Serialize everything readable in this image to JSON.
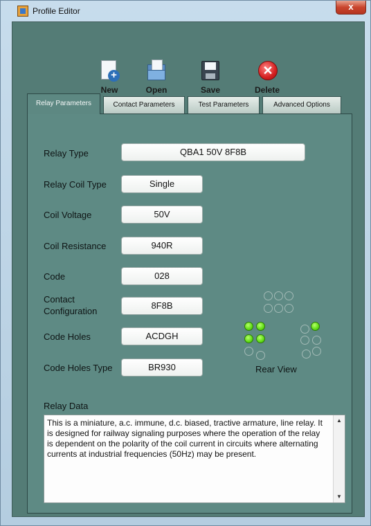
{
  "window": {
    "title": "Profile Editor",
    "close_glyph": "x"
  },
  "toolbar": {
    "new_label": "New",
    "open_label": "Open",
    "save_label": "Save",
    "delete_label": "Delete"
  },
  "tabs": [
    {
      "label": "Relay Parameters",
      "active": true
    },
    {
      "label": "Contact Parameters",
      "active": false
    },
    {
      "label": "Test Parameters",
      "active": false
    },
    {
      "label": "Advanced Options",
      "active": false
    }
  ],
  "fields": {
    "relay_type": {
      "label": "Relay Type",
      "value": "QBA1 50V 8F8B"
    },
    "relay_coil_type": {
      "label": "Relay Coil Type",
      "value": "Single"
    },
    "coil_voltage": {
      "label": "Coil Voltage",
      "value": "50V"
    },
    "coil_resistance": {
      "label": "Coil Resistance",
      "value": "940R"
    },
    "code": {
      "label": "Code",
      "value": "028"
    },
    "contact_configuration": {
      "label_line1": "Contact",
      "label_line2": "Configuration",
      "value": "8F8B"
    },
    "code_holes": {
      "label": "Code Holes",
      "value": "ACDGH"
    },
    "code_holes_type": {
      "label": "Code Holes Type",
      "value": "BR930"
    }
  },
  "rear_view": {
    "label": "Rear View",
    "holes": [
      "A",
      "B",
      "C",
      "D",
      "E",
      "F",
      "G",
      "H",
      "J",
      "K",
      "L",
      "M",
      "N",
      "P"
    ],
    "lit": [
      "A",
      "C",
      "D",
      "G",
      "H"
    ],
    "colors": {
      "lit": "#5fdc15",
      "unlit_outline": "#a4bbb7"
    }
  },
  "relay_data": {
    "label": "Relay Data",
    "text": "This is a miniature, a.c. immune, d.c. biased, tractive armature, line relay. It is designed for railway signaling purposes where the operation of the relay is dependent on the polarity of the coil current in circuits where alternating currents at industrial frequencies (50Hz) may be present."
  },
  "scroll": {
    "up_glyph": "▲",
    "down_glyph": "▼"
  },
  "colors": {
    "panel_bg": "#5e8a84",
    "active_tab_bg": "#5d8882",
    "frame_bg": "#547c76"
  }
}
